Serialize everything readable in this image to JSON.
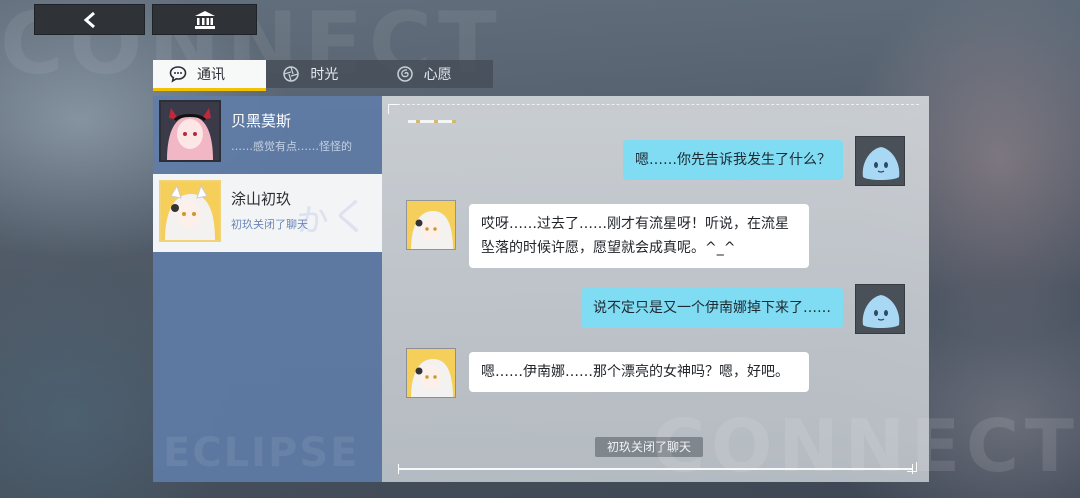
{
  "background": {
    "watermark_top": "CONNECT",
    "watermark_bottom": "CONNECT",
    "watermark_list": "ECLIPSE"
  },
  "top_bar": {
    "back_icon": "chevron-left-icon",
    "home_icon": "bank-icon"
  },
  "tabs": [
    {
      "label": "通讯",
      "icon": "chat-bubble-icon",
      "active": true
    },
    {
      "label": "时光",
      "icon": "aperture-icon",
      "active": false
    },
    {
      "label": "心愿",
      "icon": "swirl-icon",
      "active": false
    }
  ],
  "contacts": [
    {
      "name": "贝黑莫斯",
      "preview": "……感觉有点……怪怪的",
      "selected": false
    },
    {
      "name": "涂山初玖",
      "preview": "初玖关闭了聊天",
      "selected": true
    }
  ],
  "chat": {
    "messages": [
      {
        "from": "me",
        "text": "嗯……你先告诉我发生了什么？"
      },
      {
        "from": "other",
        "text": "哎呀……过去了……刚才有流星呀！听说，在流星坠落的时候许愿，愿望就会成真呢。^_^"
      },
      {
        "from": "me",
        "text": "说不定只是又一个伊南娜掉下来了……"
      },
      {
        "from": "other",
        "text": "嗯……伊南娜……那个漂亮的女神吗？嗯，好吧。"
      }
    ],
    "system_note": "初玖关闭了聊天"
  },
  "colors": {
    "accent": "#f2c200",
    "my_bubble": "#7fdcf2",
    "list_bg": "#607daa"
  }
}
